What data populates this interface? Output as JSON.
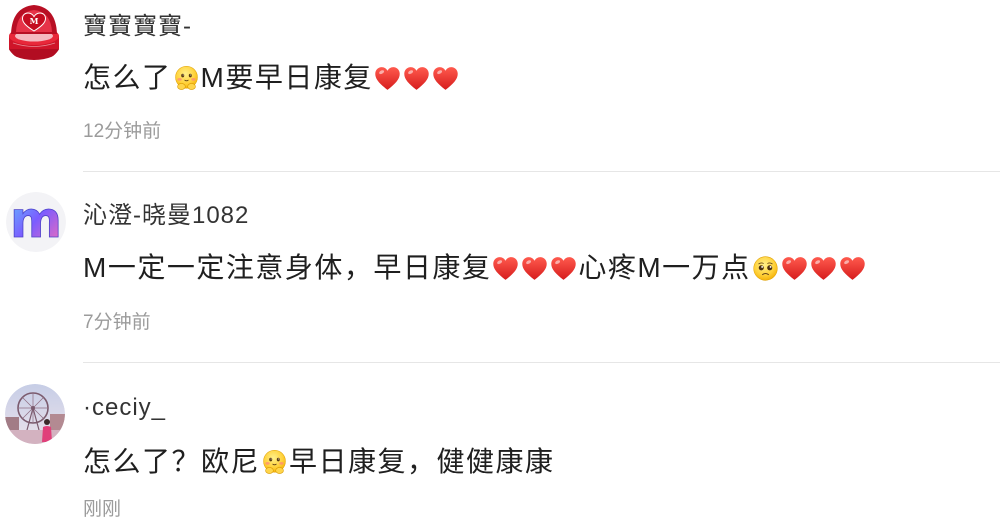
{
  "colors": {
    "background": "#ffffff",
    "text": "#1f1f1f",
    "username": "#333333",
    "muted": "#9b9b9b",
    "divider": "#e6e6e6",
    "heart": "#e8312f"
  },
  "comments": [
    {
      "username": "寶寶寶寶-",
      "avatar": {
        "icon": "ring-box-avatar",
        "letter": "M"
      },
      "segments": [
        {
          "text": "怎么了"
        },
        {
          "icon": "hug-emoji-icon"
        },
        {
          "text": "M要早日康复"
        },
        {
          "icon": "heart-icon"
        },
        {
          "icon": "heart-icon"
        },
        {
          "icon": "heart-icon"
        }
      ],
      "time": "12分钟前"
    },
    {
      "username": "沁澄-晓曼1082",
      "avatar": {
        "icon": "letter-m-avatar",
        "letter": "m"
      },
      "segments": [
        {
          "text": "M一定一定注意身体，早日康复"
        },
        {
          "icon": "heart-icon"
        },
        {
          "icon": "heart-icon"
        },
        {
          "icon": "heart-icon"
        },
        {
          "text": "心疼M一万点"
        },
        {
          "icon": "sad-emoji-icon"
        },
        {
          "icon": "heart-icon"
        },
        {
          "icon": "heart-icon"
        },
        {
          "icon": "heart-icon"
        }
      ],
      "time": "7分钟前"
    },
    {
      "username": "·ceciy_",
      "avatar": {
        "icon": "ferris-wheel-photo-avatar"
      },
      "segments": [
        {
          "text": "怎么了？欧尼"
        },
        {
          "icon": "hug-emoji-icon"
        },
        {
          "text": "早日康复，健健康康"
        }
      ],
      "time": "刚刚"
    }
  ]
}
